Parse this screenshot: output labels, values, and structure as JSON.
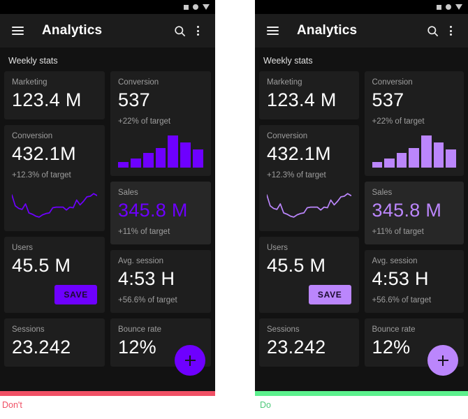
{
  "statusbar": {
    "icons": [
      "square-icon",
      "circle-icon",
      "triangle-down-icon"
    ]
  },
  "appbar": {
    "menu_icon": "hamburger-menu-icon",
    "title": "Analytics",
    "search_icon": "search-icon",
    "overflow_icon": "more-vertical-icon"
  },
  "section": {
    "title": "Weekly stats"
  },
  "cards": {
    "marketing": {
      "label": "Marketing",
      "value": "123.4 M"
    },
    "conversion2": {
      "label": "Conversion",
      "value": "537",
      "sub": "+22% of target"
    },
    "conversion1": {
      "label": "Conversion",
      "value": "432.1M",
      "sub": "+12.3% of target"
    },
    "sales": {
      "label": "Sales",
      "value": "345.8 M",
      "sub": "+11% of target"
    },
    "users": {
      "label": "Users",
      "value": "45.5 M",
      "save_label": "SAVE"
    },
    "avgsession": {
      "label": "Avg. session",
      "value": "4:53 H",
      "sub": "+56.6% of target"
    },
    "sessions": {
      "label": "Sessions",
      "value": "23.242"
    },
    "bounce": {
      "label": "Bounce rate",
      "value": "12%"
    }
  },
  "fab": {
    "icon": "plus-icon",
    "label": "add"
  },
  "panels": {
    "left": {
      "name": "Don't",
      "accent": "#6e00ff",
      "bar_color": "#f05065",
      "caption_color": "#f05065"
    },
    "right": {
      "name": "Do",
      "accent": "#bb86fc",
      "bar_color": "#5cf08d",
      "caption_color": "#4ec97a"
    }
  },
  "captions": {
    "dont": "Don't",
    "do": "Do"
  },
  "chart_data": [
    {
      "type": "bar",
      "title": "Conversion weekly bars",
      "categories": [
        "1",
        "2",
        "3",
        "4",
        "5",
        "6",
        "7"
      ],
      "values": [
        8,
        14,
        22,
        29,
        48,
        38,
        27
      ],
      "xlabel": "",
      "ylabel": "",
      "ylim": [
        0,
        50
      ],
      "grid": false,
      "legend": "none"
    },
    {
      "type": "line",
      "title": "Conversion trend sparkline",
      "x": [
        0,
        1,
        2,
        3,
        4,
        5,
        6,
        7,
        8,
        9,
        10,
        11,
        12,
        13,
        14,
        15,
        16,
        17,
        18,
        19,
        20,
        21,
        22,
        23,
        24,
        25
      ],
      "values": [
        78,
        44,
        36,
        33,
        50,
        22,
        18,
        12,
        9,
        16,
        20,
        22,
        38,
        40,
        40,
        40,
        31,
        40,
        38,
        62,
        47,
        58,
        72,
        74,
        82,
        76
      ],
      "xlabel": "",
      "ylabel": "",
      "ylim": [
        0,
        100
      ],
      "grid": false,
      "legend": "none"
    }
  ]
}
